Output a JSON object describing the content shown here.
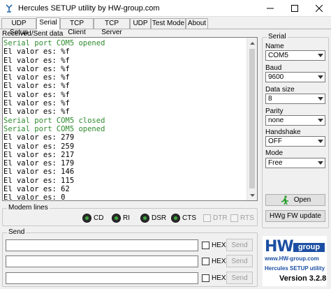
{
  "window": {
    "title": "Hercules SETUP utility by HW-group.com",
    "icon": "hercules-app-icon",
    "controls": [
      "minimize-icon",
      "maximize-icon",
      "close-icon"
    ]
  },
  "tabs": [
    {
      "label": "UDP Setup",
      "active": false
    },
    {
      "label": "Serial",
      "active": true
    },
    {
      "label": "TCP Client",
      "active": false
    },
    {
      "label": "TCP Server",
      "active": false
    },
    {
      "label": "UDP",
      "active": false
    },
    {
      "label": "Test Mode",
      "active": false
    },
    {
      "label": "About",
      "active": false
    }
  ],
  "received": {
    "label": "Received/Sent data",
    "lines": [
      {
        "text": "Serial port COM5 opened",
        "kind": "status"
      },
      {
        "text": "El valor es: %f",
        "kind": "normal"
      },
      {
        "text": "El valor es: %f",
        "kind": "normal"
      },
      {
        "text": "El valor es: %f",
        "kind": "normal"
      },
      {
        "text": "El valor es: %f",
        "kind": "normal"
      },
      {
        "text": "El valor es: %f",
        "kind": "normal"
      },
      {
        "text": "El valor es: %f",
        "kind": "normal"
      },
      {
        "text": "El valor es: %f",
        "kind": "normal"
      },
      {
        "text": "El valor es: %f",
        "kind": "normal"
      },
      {
        "text": "Serial port COM5 closed",
        "kind": "status"
      },
      {
        "text": "Serial port COM5 opened",
        "kind": "status"
      },
      {
        "text": "El valor es: 279",
        "kind": "normal"
      },
      {
        "text": "El valor es: 259",
        "kind": "normal"
      },
      {
        "text": "El valor es: 217",
        "kind": "normal"
      },
      {
        "text": "El valor es: 179",
        "kind": "normal"
      },
      {
        "text": "El valor es: 146",
        "kind": "normal"
      },
      {
        "text": "El valor es: 115",
        "kind": "normal"
      },
      {
        "text": "El valor es: 62",
        "kind": "normal"
      },
      {
        "text": "El valor es: 0",
        "kind": "normal"
      }
    ],
    "status_color": "#2e8b2e"
  },
  "modem": {
    "title": "Modem lines",
    "leds": [
      "CD",
      "RI",
      "DSR",
      "CTS"
    ],
    "checks": [
      "DTR",
      "RTS"
    ]
  },
  "send": {
    "title": "Send",
    "hex_label": "HEX",
    "button_label": "Send"
  },
  "serial": {
    "title": "Serial",
    "name_label": "Name",
    "name_value": "COM5",
    "baud_label": "Baud",
    "baud_value": "9600",
    "datasize_label": "Data size",
    "datasize_value": "8",
    "parity_label": "Parity",
    "parity_value": "none",
    "handshake_label": "Handshake",
    "handshake_value": "OFF",
    "mode_label": "Mode",
    "mode_value": "Free",
    "open_label": "Open",
    "fw_label": "HWg FW update"
  },
  "logo": {
    "hw": "HW",
    "group": "group",
    "www": "www.HW-group.com",
    "product": "Hercules SETUP utility",
    "version": "Version  3.2.8",
    "brand_color": "#1c4fa3"
  }
}
